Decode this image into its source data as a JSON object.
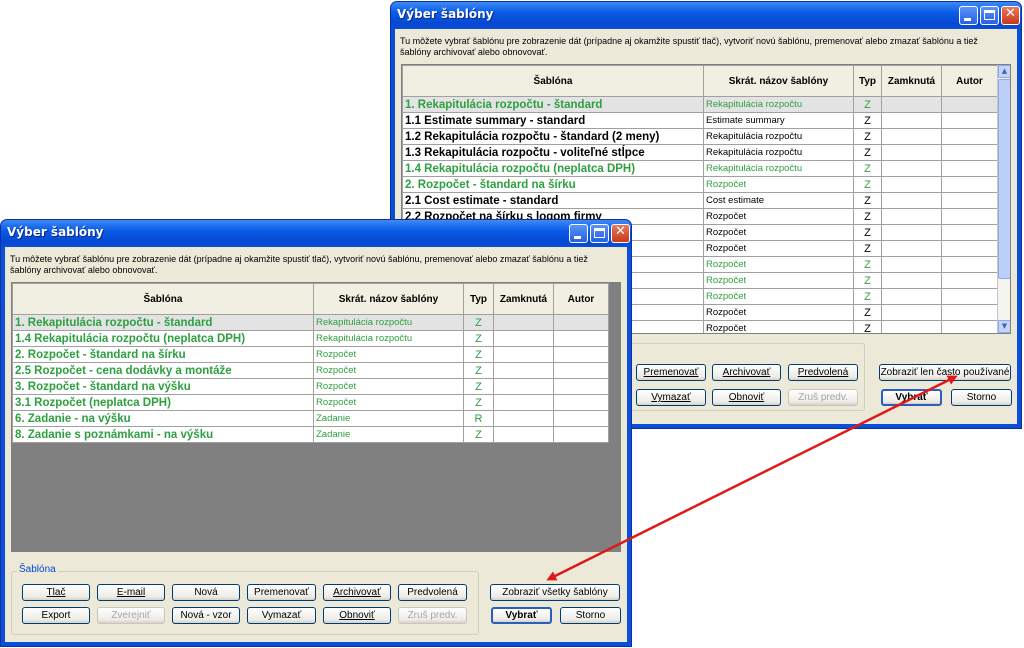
{
  "colors": {
    "green_row": "#2ea040",
    "title_blue": "#0a4fd6",
    "arrow_red": "#e01818"
  },
  "back_window": {
    "title": "Výber šablóny",
    "desc_line1": "Tu môžete vybrať šablónu pre zobrazenie dát (prípadne aj okamžite spustiť tlač), vytvoriť novú šablónu, premenovať alebo zmazať šablónu a tiež",
    "desc_line2": "šablóny archivovať alebo obnovovať.",
    "columns": [
      "Šablóna",
      "Skrát. názov šablóny",
      "Typ",
      "Zamknutá",
      "Autor"
    ],
    "rows": [
      {
        "name": "1. Rekapitulácia rozpočtu - štandard",
        "short": "Rekapitulácia rozpočtu",
        "typ": "Z",
        "color": "green",
        "selected": true
      },
      {
        "name": "1.1 Estimate summary - standard",
        "short": "Estimate summary",
        "typ": "Z",
        "color": "black"
      },
      {
        "name": "1.2 Rekapitulácia rozpočtu - štandard (2 meny)",
        "short": "Rekapitulácia rozpočtu",
        "typ": "Z",
        "color": "black"
      },
      {
        "name": "1.3 Rekapitulácia rozpočtu  - voliteľné stĺpce",
        "short": "Rekapitulácia rozpočtu",
        "typ": "Z",
        "color": "black"
      },
      {
        "name": "1.4 Rekapitulácia rozpočtu (neplatca DPH)",
        "short": "Rekapitulácia rozpočtu",
        "typ": "Z",
        "color": "green"
      },
      {
        "name": "2. Rozpočet - štandard na šírku",
        "short": "Rozpočet",
        "typ": "Z",
        "color": "green"
      },
      {
        "name": "2.1 Cost estimate - standard",
        "short": "Cost estimate",
        "typ": "Z",
        "color": "black"
      },
      {
        "name": "2.2 Rozpočet na šírku s logom firmy",
        "short": "Rozpočet",
        "typ": "Z",
        "color": "black"
      },
      {
        "name": "",
        "short": "Rozpočet",
        "typ": "Z",
        "color": "black"
      },
      {
        "name": "",
        "short": "Rozpočet",
        "typ": "Z",
        "color": "black"
      },
      {
        "name": "",
        "short": "Rozpočet",
        "typ": "Z",
        "color": "green"
      },
      {
        "name": "",
        "short": "Rozpočet",
        "typ": "Z",
        "color": "green"
      },
      {
        "name": "",
        "short": "Rozpočet",
        "typ": "Z",
        "color": "green"
      },
      {
        "name": "",
        "short": "Rozpočet",
        "typ": "Z",
        "color": "black"
      },
      {
        "name": "",
        "short": "Rozpočet",
        "typ": "Z",
        "color": "black"
      }
    ],
    "buttons": {
      "premenovat": "Premenovať",
      "archivovat": "Archivovať",
      "predvolena": "Predvolená",
      "vymazat": "Vymazať",
      "obnovit": "Obnoviť",
      "zrus_predv": "Zruš predv.",
      "toggle": "Zobraziť len často používané",
      "vybrat": "Vybrať",
      "storno": "Storno"
    }
  },
  "front_window": {
    "title": "Výber šablóny",
    "desc_line1": "Tu môžete vybrať šablónu pre zobrazenie dát (prípadne aj okamžite spustiť tlač), vytvoriť novú šablónu, premenovať alebo zmazať šablónu a tiež",
    "desc_line2": "šablóny archivovať alebo obnovovať.",
    "columns": [
      "Šablóna",
      "Skrát. názov šablóny",
      "Typ",
      "Zamknutá",
      "Autor"
    ],
    "rows": [
      {
        "name": "1. Rekapitulácia rozpočtu - štandard",
        "short": "Rekapitulácia rozpočtu",
        "typ": "Z",
        "color": "green",
        "selected": true
      },
      {
        "name": "1.4 Rekapitulácia rozpočtu (neplatca DPH)",
        "short": "Rekapitulácia rozpočtu",
        "typ": "Z",
        "color": "green"
      },
      {
        "name": "2. Rozpočet - štandard na šírku",
        "short": "Rozpočet",
        "typ": "Z",
        "color": "green"
      },
      {
        "name": "2.5 Rozpočet - cena dodávky a montáže",
        "short": "Rozpočet",
        "typ": "Z",
        "color": "green"
      },
      {
        "name": "3. Rozpočet - štandard na výšku",
        "short": "Rozpočet",
        "typ": "Z",
        "color": "green"
      },
      {
        "name": "3.1 Rozpočet (neplatca DPH)",
        "short": "Rozpočet",
        "typ": "Z",
        "color": "green"
      },
      {
        "name": "6. Zadanie - na výšku",
        "short": "Zadanie",
        "typ": "R",
        "color": "green"
      },
      {
        "name": "8. Zadanie s poznámkami - na výšku",
        "short": "Zadanie",
        "typ": "Z",
        "color": "green"
      }
    ],
    "group_label": "Šablóna",
    "buttons": {
      "tlac": "Tlač",
      "email": "E-mail",
      "nova": "Nová",
      "premenovat": "Premenovať",
      "archivovat": "Archivovať",
      "predvolena": "Predvolená",
      "export": "Export",
      "zverejnit": "Zverejniť",
      "nova_vzor": "Nová - vzor",
      "vymazat": "Vymazať",
      "obnovit": "Obnoviť",
      "zrus_predv": "Zruš predv.",
      "toggle": "Zobraziť všetky šablóny",
      "vybrat": "Vybrať",
      "storno": "Storno"
    }
  }
}
